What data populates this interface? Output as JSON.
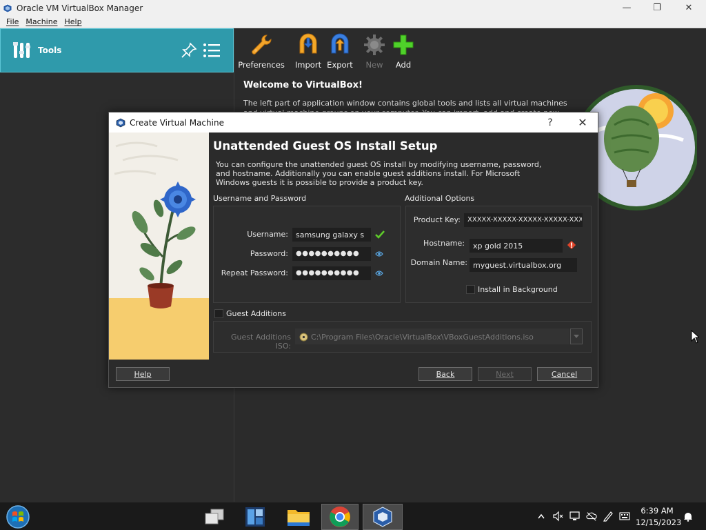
{
  "window": {
    "title": "Oracle VM VirtualBox Manager",
    "minimize_glyph": "—",
    "restore_glyph": "❐",
    "close_glyph": "✕"
  },
  "menu": [
    "File",
    "Machine",
    "Help"
  ],
  "left_pane": {
    "tools_label": "Tools"
  },
  "toolbar": {
    "preferences": "Preferences",
    "import": "Import",
    "export": "Export",
    "new": "New",
    "add": "Add"
  },
  "welcome": {
    "title": "Welcome to VirtualBox!",
    "text": "The left part of application window contains global tools and lists all virtual machines and virtual machine groups on your computer. You can import, add and create new VMs using"
  },
  "dialog": {
    "title": "Create Virtual Machine",
    "help_glyph": "?",
    "close_glyph": "✕",
    "heading": "Unattended Guest OS Install Setup",
    "description": "You can configure the unattended guest OS install by modifying username, password, and hostname. Additionally you can enable guest additions install. For Microsoft Windows guests it is possible to provide a product key.",
    "username_group": {
      "title": "Username and Password",
      "username_label": "Username:",
      "username_value": "samsung galaxy s",
      "password_label": "Password:",
      "password_value": "●●●●●●●●●●",
      "repeat_password_label": "Repeat Password:",
      "repeat_password_value": "●●●●●●●●●●"
    },
    "additional_group": {
      "title": "Additional Options",
      "product_key_label": "Product Key:",
      "product_key_value": "XXXXX-XXXXX-XXXXX-XXXXX-XXXXX",
      "hostname_label": "Hostname:",
      "hostname_value": "xp gold 2015",
      "domain_label": "Domain Name:",
      "domain_value": "myguest.virtualbox.org",
      "install_bg_label": "Install in Background"
    },
    "guest_additions": {
      "label": "Guest Additions",
      "iso_label": "Guest Additions ISO:",
      "iso_value": "C:\\Program Files\\Oracle\\VirtualBox\\VBoxGuestAdditions.iso"
    },
    "buttons": {
      "help": "Help",
      "back": "Back",
      "next": "Next",
      "cancel": "Cancel"
    }
  },
  "taskbar": {
    "time": "6:39 AM",
    "date": "12/15/2023"
  },
  "colors": {
    "accent": "#2f9aab",
    "dialog_bg": "#2b2b2b",
    "valid_green": "#5ecb2a",
    "warning_red": "#e0442a"
  }
}
